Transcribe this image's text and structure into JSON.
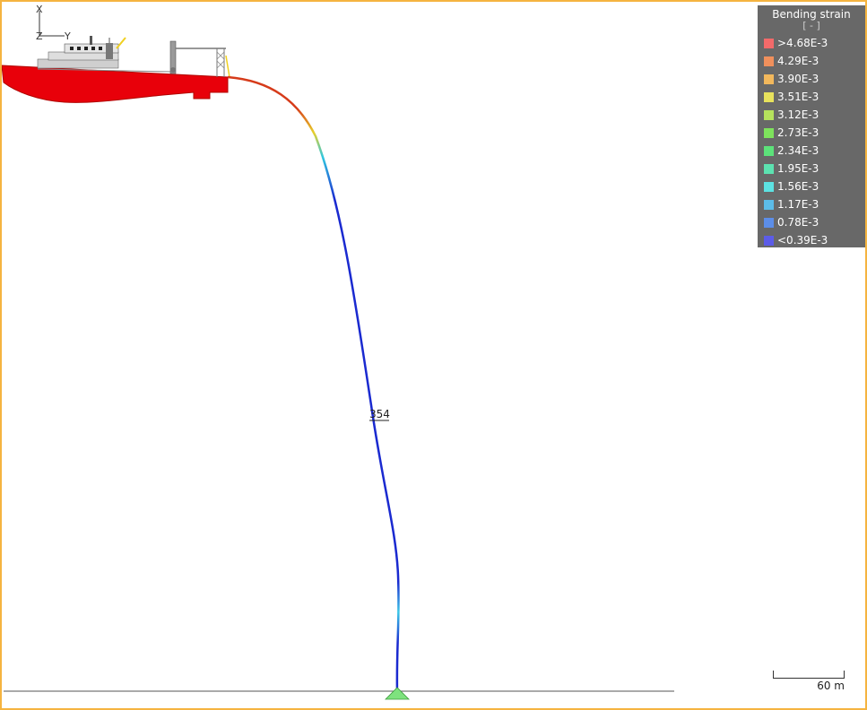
{
  "legend": {
    "title": "Bending strain",
    "unit": "[ - ]",
    "items": [
      {
        "label": ">4.68E-3",
        "color": "#f26a6a"
      },
      {
        "label": "4.29E-3",
        "color": "#f0905c"
      },
      {
        "label": "3.90E-3",
        "color": "#f2b85c"
      },
      {
        "label": "3.51E-3",
        "color": "#e8e25c"
      },
      {
        "label": "3.12E-3",
        "color": "#b6e25c"
      },
      {
        "label": "2.73E-3",
        "color": "#7ee25c"
      },
      {
        "label": "2.34E-3",
        "color": "#5ce27a"
      },
      {
        "label": "1.95E-3",
        "color": "#5ce2b0"
      },
      {
        "label": "1.56E-3",
        "color": "#5ce2e2"
      },
      {
        "label": "1.17E-3",
        "color": "#5cbce8"
      },
      {
        "label": "0.78E-3",
        "color": "#5c8ee8"
      },
      {
        "label": "<0.39E-3",
        "color": "#5c5ce8"
      }
    ]
  },
  "riser_label": "354",
  "scale_label": "60 m",
  "axes": {
    "x": "X",
    "y": "Y",
    "z": "Z"
  }
}
